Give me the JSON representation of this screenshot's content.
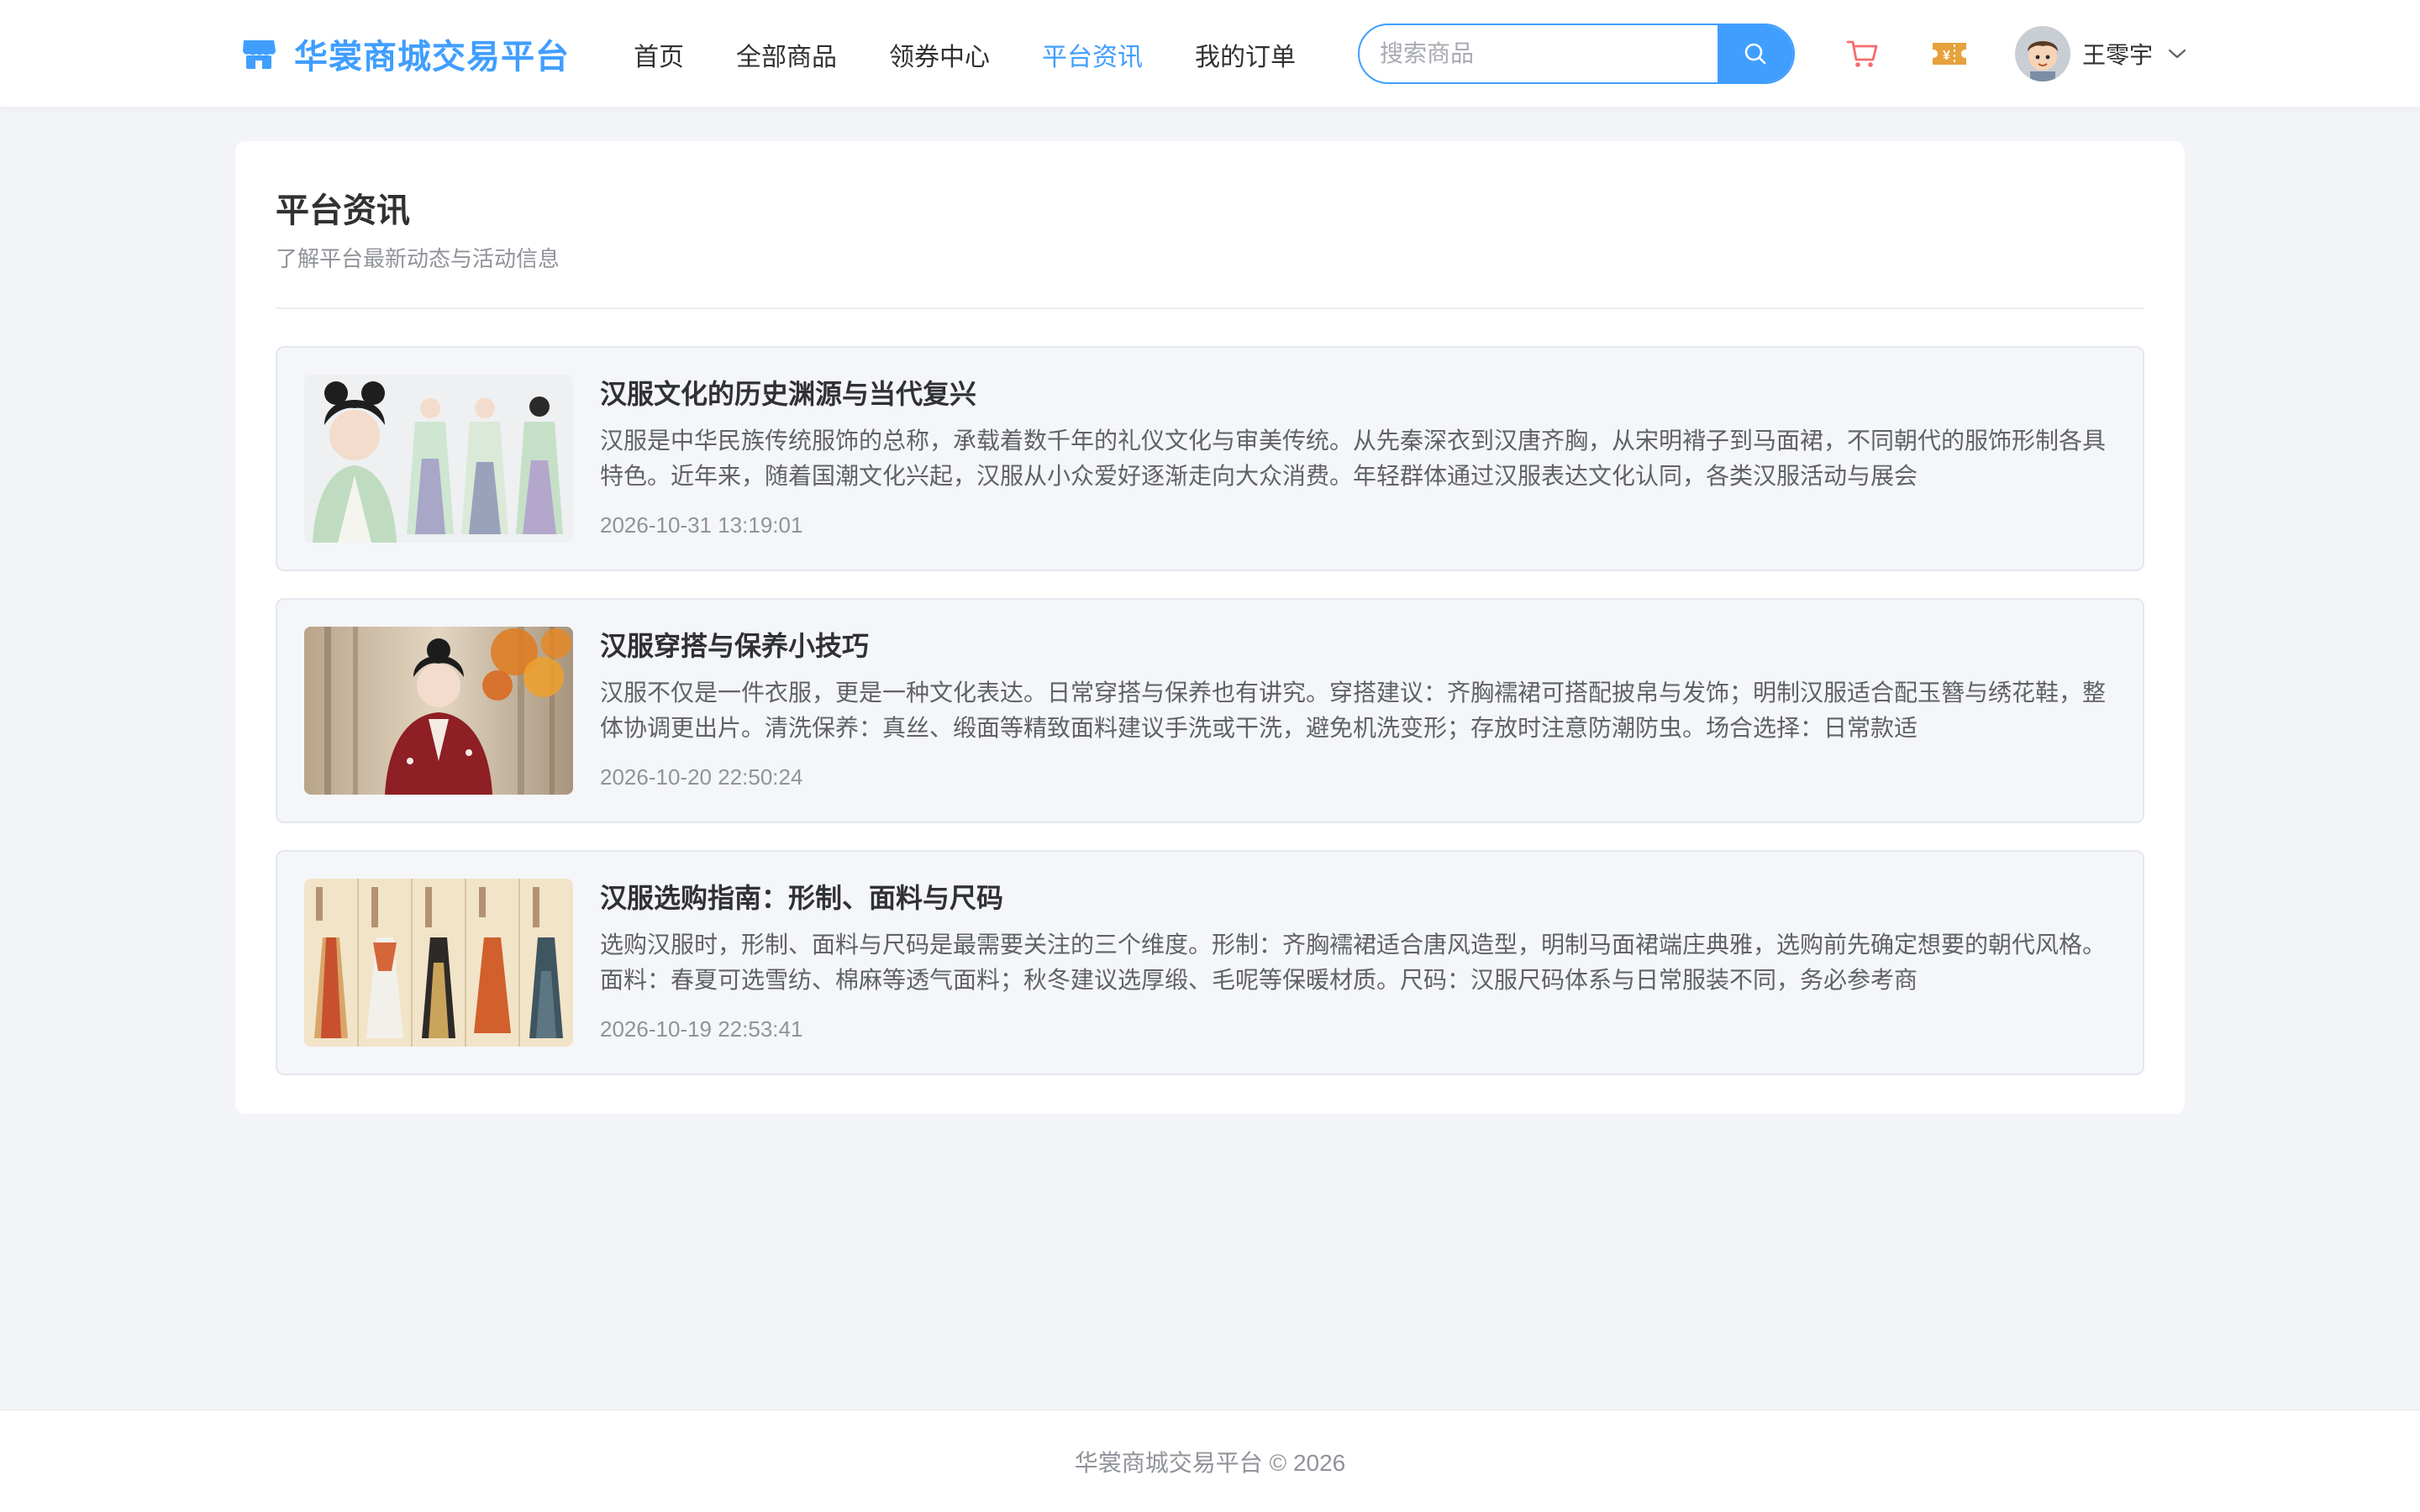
{
  "header": {
    "logo_text": "华裳商城交易平台",
    "nav": [
      {
        "label": "首页",
        "active": false
      },
      {
        "label": "全部商品",
        "active": false
      },
      {
        "label": "领券中心",
        "active": false
      },
      {
        "label": "平台资讯",
        "active": true
      },
      {
        "label": "我的订单",
        "active": false
      }
    ],
    "search": {
      "placeholder": "搜索商品",
      "value": ""
    },
    "icons": {
      "store": "store-icon",
      "search": "search-icon",
      "cart": "cart-icon",
      "coupon": "coupon-icon",
      "chevron": "chevron-down-icon"
    },
    "user": {
      "name": "王零宇"
    }
  },
  "main": {
    "title": "平台资讯",
    "subtitle": "了解平台最新动态与活动信息",
    "news": [
      {
        "title": "汉服文化的历史渊源与当代复兴",
        "summary": "汉服是中华民族传统服饰的总称，承载着数千年的礼仪文化与审美传统。从先秦深衣到汉唐齐胸，从宋明褙子到马面裙，不同朝代的服饰形制各具特色。近年来，随着国潮文化兴起，汉服从小众爱好逐渐走向大众消费。年轻群体通过汉服表达文化认同，各类汉服活动与展会",
        "date": "2026-10-31 13:19:01"
      },
      {
        "title": "汉服穿搭与保养小技巧",
        "summary": "汉服不仅是一件衣服，更是一种文化表达。日常穿搭与保养也有讲究。穿搭建议：齐胸襦裙可搭配披帛与发饰；明制汉服适合配玉簪与绣花鞋，整体协调更出片。清洗保养：真丝、缎面等精致面料建议手洗或干洗，避免机洗变形；存放时注意防潮防虫。场合选择：日常款适",
        "date": "2026-10-20 22:50:24"
      },
      {
        "title": "汉服选购指南：形制、面料与尺码",
        "summary": "选购汉服时，形制、面料与尺码是最需要关注的三个维度。形制：齐胸襦裙适合唐风造型，明制马面裙端庄典雅，选购前先确定想要的朝代风格。面料：春夏可选雪纺、棉麻等透气面料；秋冬建议选厚缎、毛呢等保暖材质。尺码：汉服尺码体系与日常服装不同，务必参考商",
        "date": "2026-10-19 22:53:41"
      }
    ]
  },
  "footer": {
    "text": "华裳商城交易平台 © 2026"
  },
  "colors": {
    "accent": "#409eff",
    "page_bg": "#f3f4f8",
    "coupon": "#e6a23c",
    "cart": "#f56c6c"
  }
}
